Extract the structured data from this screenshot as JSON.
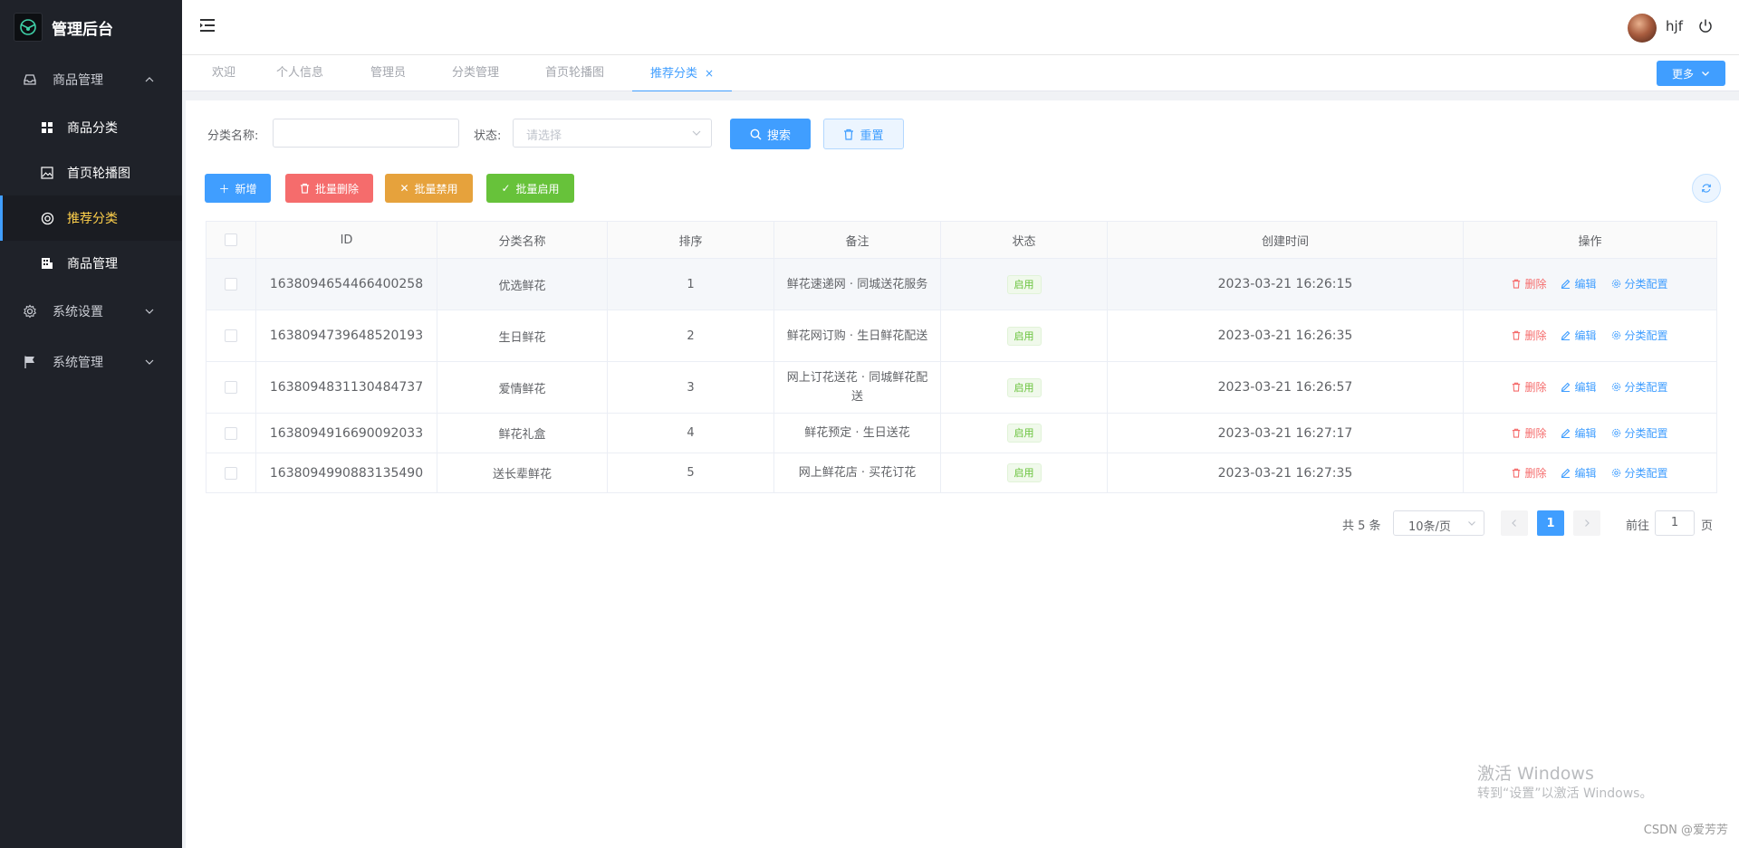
{
  "app": {
    "brand_title": "管理后台",
    "accent_color": "#409eff",
    "sidebar_bg": "#1f2229",
    "active_menu_color": "#ffd04b"
  },
  "sidebar": {
    "groups": [
      {
        "label": "商品管理",
        "icon": "inbox-icon",
        "expanded": true
      },
      {
        "label": "系统设置",
        "icon": "gear-icon",
        "expanded": false
      },
      {
        "label": "系统管理",
        "icon": "flag-icon",
        "expanded": false
      }
    ],
    "sub_items": [
      {
        "label": "商品分类",
        "icon": "grid-icon"
      },
      {
        "label": "首页轮播图",
        "icon": "image-icon"
      },
      {
        "label": "推荐分类",
        "icon": "lifebuoy-icon",
        "active": true
      },
      {
        "label": "商品管理",
        "icon": "building-icon"
      }
    ]
  },
  "header": {
    "username": "hjf"
  },
  "tabs": {
    "items": [
      {
        "label": "欢迎"
      },
      {
        "label": "个人信息"
      },
      {
        "label": "管理员"
      },
      {
        "label": "分类管理"
      },
      {
        "label": "首页轮播图"
      },
      {
        "label": "推荐分类",
        "active": true,
        "close": "×"
      }
    ],
    "more_label": "更多"
  },
  "filter": {
    "name_label": "分类名称:",
    "name_value": "",
    "status_label": "状态:",
    "status_placeholder": "请选择",
    "search_label": "搜索",
    "reset_label": "重置"
  },
  "toolbar": {
    "add_label": "新增",
    "batch_delete_label": "批量删除",
    "batch_disable_label": "批量禁用",
    "batch_enable_label": "批量启用"
  },
  "table": {
    "columns": [
      "ID",
      "分类名称",
      "排序",
      "备注",
      "状态",
      "创建时间",
      "操作"
    ],
    "rows": [
      {
        "id": "1638094654466400258",
        "name": "优选鲜花",
        "sort": "1",
        "remark": "鲜花速递网 · 同城送花服务",
        "status": "启用",
        "created": "2023-03-21 16:26:15"
      },
      {
        "id": "1638094739648520193",
        "name": "生日鲜花",
        "sort": "2",
        "remark": "鲜花网订购 · 生日鲜花配送",
        "status": "启用",
        "created": "2023-03-21 16:26:35"
      },
      {
        "id": "1638094831130484737",
        "name": "爱情鲜花",
        "sort": "3",
        "remark": "网上订花送花 · 同城鲜花配送",
        "status": "启用",
        "created": "2023-03-21 16:26:57"
      },
      {
        "id": "1638094916690092033",
        "name": "鲜花礼盒",
        "sort": "4",
        "remark": "鲜花预定 · 生日送花",
        "status": "启用",
        "created": "2023-03-21 16:27:17"
      },
      {
        "id": "1638094990883135490",
        "name": "送长辈鲜花",
        "sort": "5",
        "remark": "网上鲜花店 · 买花订花",
        "status": "启用",
        "created": "2023-03-21 16:27:35"
      }
    ],
    "ops": {
      "delete": "删除",
      "edit": "编辑",
      "config": "分类配置"
    }
  },
  "pagination": {
    "total": "共 5 条",
    "page_size": "10条/页",
    "current_page": "1",
    "goto_prefix": "前往",
    "goto_value": "1",
    "goto_suffix": "页"
  },
  "overlay": {
    "activate_title": "激活 Windows",
    "activate_sub": "转到“设置”以激活 Windows。",
    "credit": "CSDN @爱芳芳"
  }
}
